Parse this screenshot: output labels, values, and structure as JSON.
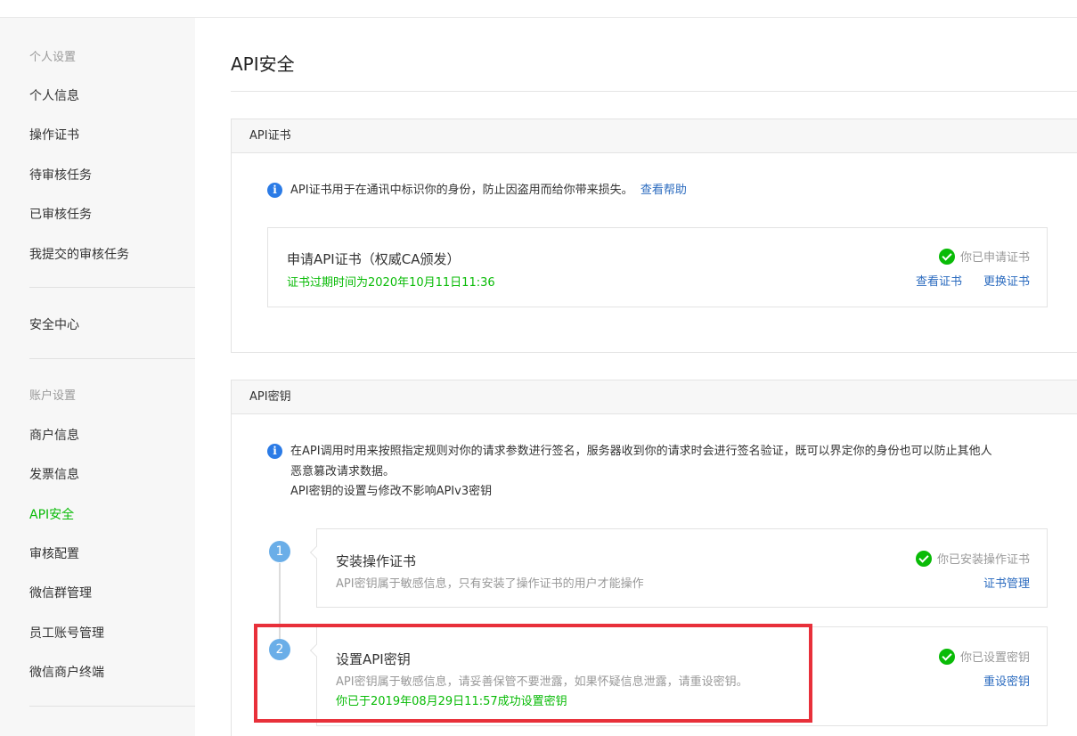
{
  "sidebar": {
    "group1_title": "个人设置",
    "group1_items": [
      "个人信息",
      "操作证书",
      "待审核任务",
      "已审核任务",
      "我提交的审核任务"
    ],
    "security_center": "安全中心",
    "group2_title": "账户设置",
    "group2_items": [
      "商户信息",
      "发票信息",
      "API安全",
      "审核配置",
      "微信群管理",
      "员工账号管理",
      "微信商户终端"
    ],
    "active_item": "API安全"
  },
  "page": {
    "title": "API安全"
  },
  "cert_panel": {
    "title": "API证书",
    "info_text": "API证书用于在通讯中标识你的身份，防止因盗用而给你带来损失。",
    "help_link": "查看帮助",
    "card": {
      "title": "申请API证书（权威CA颁发）",
      "expire_text": "证书过期时间为2020年10月11日11:36",
      "status": "你已申请证书",
      "view_link": "查看证书",
      "replace_link": "更换证书"
    }
  },
  "key_panel": {
    "title": "API密钥",
    "info_line1": "在API调用时用来按照指定规则对你的请求参数进行签名，服务器收到你的请求时会进行签名验证，既可以界定你的身份也可以防止其他人",
    "info_line2": "恶意篡改请求数据。",
    "info_line3": "API密钥的设置与修改不影响APIv3密钥",
    "step1": {
      "number": "1",
      "title": "安装操作证书",
      "desc": "API密钥属于敏感信息，只有安装了操作证书的用户才能操作",
      "status": "你已安装操作证书",
      "link": "证书管理"
    },
    "step2": {
      "number": "2",
      "title": "设置API密钥",
      "desc": "API密钥属于敏感信息，请妥善保管不要泄露，如果怀疑信息泄露，请重设密钥。",
      "success_text": "你已于2019年08月29日11:57成功设置密钥",
      "status": "你已设置密钥",
      "link": "重设密钥"
    }
  },
  "colors": {
    "accent_green": "#09bb07",
    "link_blue": "#2b6bbf",
    "highlight_red": "#e8303a",
    "info_blue": "#2b7be6"
  }
}
